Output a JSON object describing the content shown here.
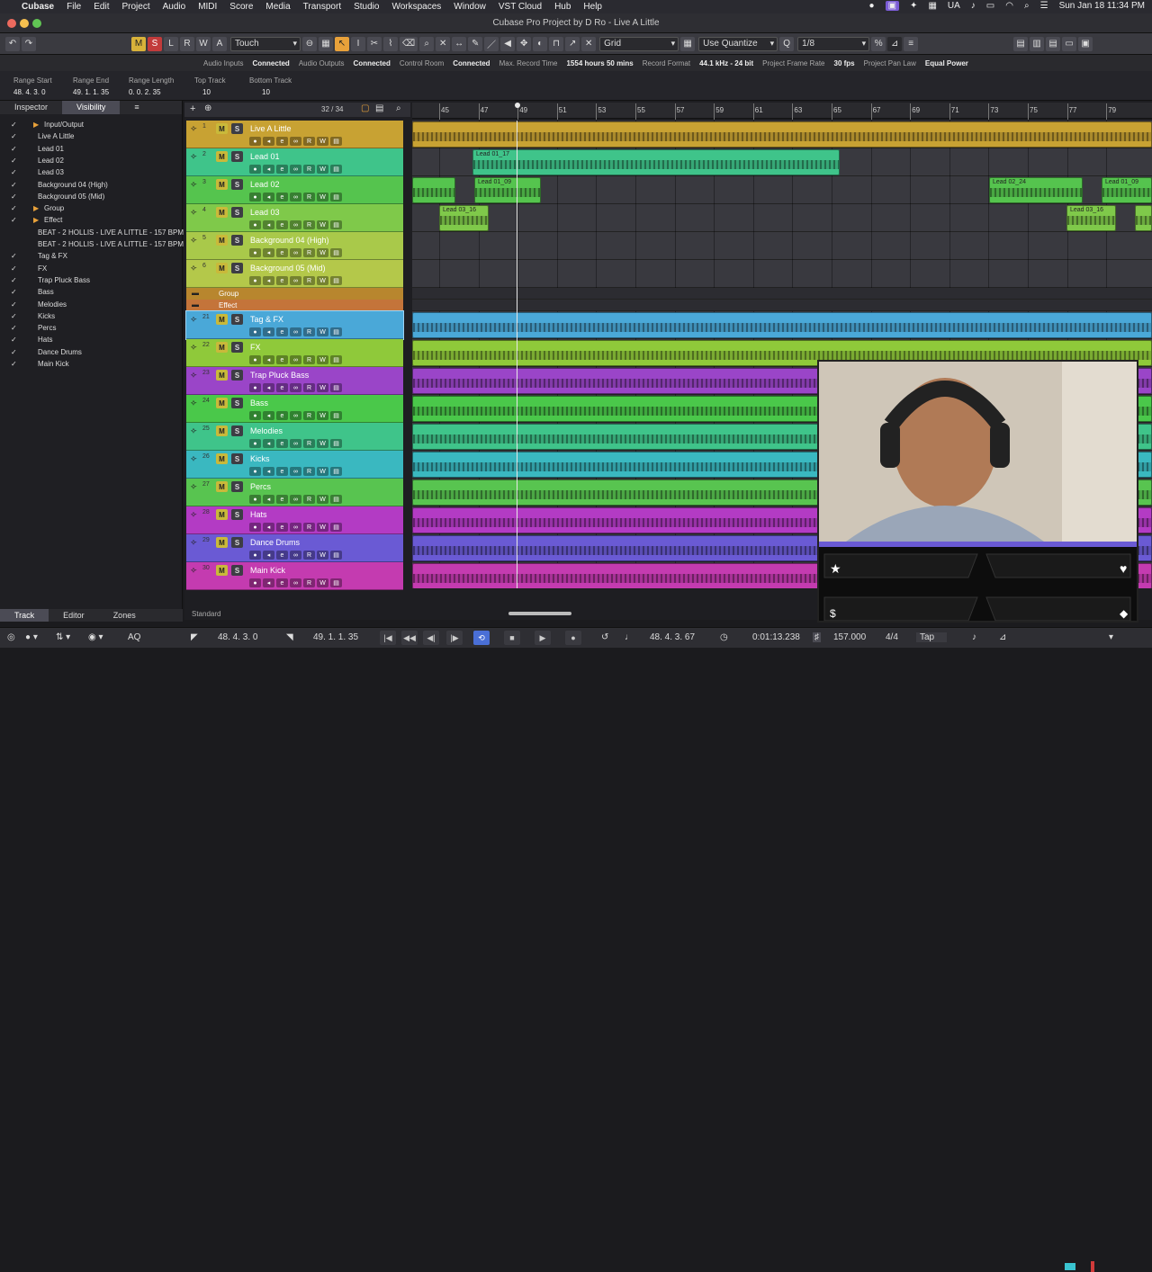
{
  "menubar": {
    "app": "Cubase",
    "items": [
      "File",
      "Edit",
      "Project",
      "Audio",
      "MIDI",
      "Score",
      "Media",
      "Transport",
      "Studio",
      "Workspaces",
      "Window",
      "VST Cloud",
      "Hub",
      "Help"
    ],
    "lang": "UA",
    "datetime": "Sun Jan 18  11:34 PM"
  },
  "window": {
    "title": "Cubase Pro Project by D Ro - Live A Little"
  },
  "toolbar": {
    "mute_label": "M",
    "solo_label": "S",
    "listen_label": "L",
    "read_label": "R",
    "write_label": "W",
    "a_label": "A",
    "automation_mode": "Touch",
    "snap_type": "Grid",
    "quantize_mode": "Use Quantize",
    "quantize_value": "1/8"
  },
  "status": {
    "audio_inputs_label": "Audio Inputs",
    "audio_inputs": "Connected",
    "audio_outputs_label": "Audio Outputs",
    "audio_outputs": "Connected",
    "control_room_label": "Control Room",
    "control_room": "Connected",
    "max_record_label": "Max. Record Time",
    "max_record": "1554 hours 50 mins",
    "record_format_label": "Record Format",
    "record_format": "44.1 kHz - 24 bit",
    "frame_rate_label": "Project Frame Rate",
    "frame_rate": "30 fps",
    "pan_law_label": "Project Pan Law",
    "pan_law": "Equal Power"
  },
  "info": {
    "range_start_label": "Range Start",
    "range_start": "48. 4. 3.   0",
    "range_end_label": "Range End",
    "range_end": "49. 1. 1. 35",
    "range_length_label": "Range Length",
    "range_length": "0. 0. 2. 35",
    "top_track_label": "Top Track",
    "top_track": "10",
    "bottom_track_label": "Bottom Track",
    "bottom_track": "10"
  },
  "leftzone": {
    "tab_inspector": "Inspector",
    "tab_visibility": "Visibility",
    "rows": [
      {
        "name": "Input/Output",
        "checked": true,
        "indent": 2,
        "folder": true
      },
      {
        "name": "Live A Little",
        "checked": true,
        "indent": 1
      },
      {
        "name": "Lead 01",
        "checked": true,
        "indent": 1
      },
      {
        "name": "Lead 02",
        "checked": true,
        "indent": 1
      },
      {
        "name": "Lead 03",
        "checked": true,
        "indent": 1
      },
      {
        "name": "Background 04 (High)",
        "checked": true,
        "indent": 1
      },
      {
        "name": "Background 05 (Mid)",
        "checked": true,
        "indent": 1
      },
      {
        "name": "Group",
        "checked": true,
        "indent": 2,
        "folder": true
      },
      {
        "name": "Effect",
        "checked": true,
        "indent": 2,
        "folder": true
      },
      {
        "name": "BEAT - 2 HOLLIS - LIVE A LITTLE - 157 BPM -",
        "checked": false,
        "indent": 1
      },
      {
        "name": "BEAT - 2 HOLLIS - LIVE A LITTLE - 157 BPM -",
        "checked": false,
        "indent": 1
      },
      {
        "name": "Tag & FX",
        "checked": true,
        "indent": 1
      },
      {
        "name": "FX",
        "checked": true,
        "indent": 1
      },
      {
        "name": "Trap Pluck Bass",
        "checked": true,
        "indent": 1
      },
      {
        "name": "Bass",
        "checked": true,
        "indent": 1
      },
      {
        "name": "Melodies",
        "checked": true,
        "indent": 1
      },
      {
        "name": "Kicks",
        "checked": true,
        "indent": 1
      },
      {
        "name": "Percs",
        "checked": true,
        "indent": 1
      },
      {
        "name": "Hats",
        "checked": true,
        "indent": 1
      },
      {
        "name": "Dance Drums",
        "checked": true,
        "indent": 1
      },
      {
        "name": "Main Kick",
        "checked": true,
        "indent": 1
      }
    ],
    "bottom_tabs": [
      "Track",
      "Editor",
      "Zones"
    ]
  },
  "project": {
    "track_count": "32 / 34",
    "ruler_ticks": [
      "45",
      "47",
      "49",
      "51",
      "53",
      "55",
      "57",
      "59",
      "61",
      "63",
      "65",
      "67",
      "69",
      "71",
      "73",
      "75",
      "77",
      "79"
    ],
    "standard_label": "Standard",
    "tracks": [
      {
        "num": "1",
        "name": "Live A Little",
        "color": "#c8a233",
        "events": [
          {
            "start": 0,
            "end": 822,
            "label": ""
          }
        ]
      },
      {
        "num": "2",
        "name": "Lead 01",
        "color": "#3fc48a",
        "events": [
          {
            "start": 67,
            "end": 475,
            "label": "Lead 01_17"
          }
        ]
      },
      {
        "num": "3",
        "name": "Lead 02",
        "color": "#55c44e",
        "events": [
          {
            "start": 0,
            "end": 48,
            "label": ""
          },
          {
            "start": 69,
            "end": 143,
            "label": "Lead 01_09"
          },
          {
            "start": 641,
            "end": 745,
            "label": "Lead 02_24"
          },
          {
            "start": 766,
            "end": 822,
            "label": "Lead 01_09"
          }
        ]
      },
      {
        "num": "4",
        "name": "Lead 03",
        "color": "#7fc94a",
        "events": [
          {
            "start": 30,
            "end": 85,
            "label": "Lead 03_16"
          },
          {
            "start": 727,
            "end": 782,
            "label": "Lead 03_16"
          },
          {
            "start": 803,
            "end": 822,
            "label": ""
          }
        ]
      },
      {
        "num": "5",
        "name": "Background 04 (High)",
        "color": "#a9c94a",
        "events": []
      },
      {
        "num": "6",
        "name": "Background 05 (Mid)",
        "color": "#b4c84a",
        "events": []
      },
      {
        "num": "21",
        "name": "Tag & FX",
        "color": "#4aa8d8",
        "events": [
          {
            "start": 0,
            "end": 822,
            "label": ""
          }
        ]
      },
      {
        "num": "22",
        "name": "FX",
        "color": "#8fc93a",
        "events": [
          {
            "start": 0,
            "end": 822,
            "label": ""
          }
        ]
      },
      {
        "num": "23",
        "name": "Trap Pluck Bass",
        "color": "#9a45c8",
        "events": [
          {
            "start": 0,
            "end": 822,
            "label": ""
          }
        ]
      },
      {
        "num": "24",
        "name": "Bass",
        "color": "#4ac84a",
        "events": [
          {
            "start": 0,
            "end": 822,
            "label": ""
          }
        ]
      },
      {
        "num": "25",
        "name": "Melodies",
        "color": "#3fc48a",
        "events": [
          {
            "start": 0,
            "end": 822,
            "label": ""
          }
        ]
      },
      {
        "num": "26",
        "name": "Kicks",
        "color": "#3ab8c0",
        "events": [
          {
            "start": 0,
            "end": 822,
            "label": ""
          }
        ]
      },
      {
        "num": "27",
        "name": "Percs",
        "color": "#58c450",
        "events": [
          {
            "start": 0,
            "end": 822,
            "label": ""
          }
        ]
      },
      {
        "num": "28",
        "name": "Hats",
        "color": "#b33bc4",
        "events": [
          {
            "start": 0,
            "end": 822,
            "label": ""
          }
        ]
      },
      {
        "num": "29",
        "name": "Dance Drums",
        "color": "#6a5ad4",
        "events": [
          {
            "start": 0,
            "end": 822,
            "label": ""
          }
        ]
      },
      {
        "num": "30",
        "name": "Main Kick",
        "color": "#c43bb0",
        "events": [
          {
            "start": 0,
            "end": 822,
            "label": ""
          }
        ]
      }
    ],
    "folders": [
      {
        "name": "Group",
        "color": "#b8862e"
      },
      {
        "name": "Effect",
        "color": "#c4743a"
      }
    ]
  },
  "transport": {
    "left_locator": "48. 4. 3.   0",
    "right_locator": "49. 1. 1. 35",
    "position_bars": "48. 4. 3. 67",
    "position_time": "0:01:13.238",
    "tempo": "157.000",
    "signature": "4/4",
    "tap_label": "Tap",
    "aq_label": "AQ"
  },
  "colors": {
    "cursor": "#e8e8e8",
    "accent": "#e8a13a"
  }
}
